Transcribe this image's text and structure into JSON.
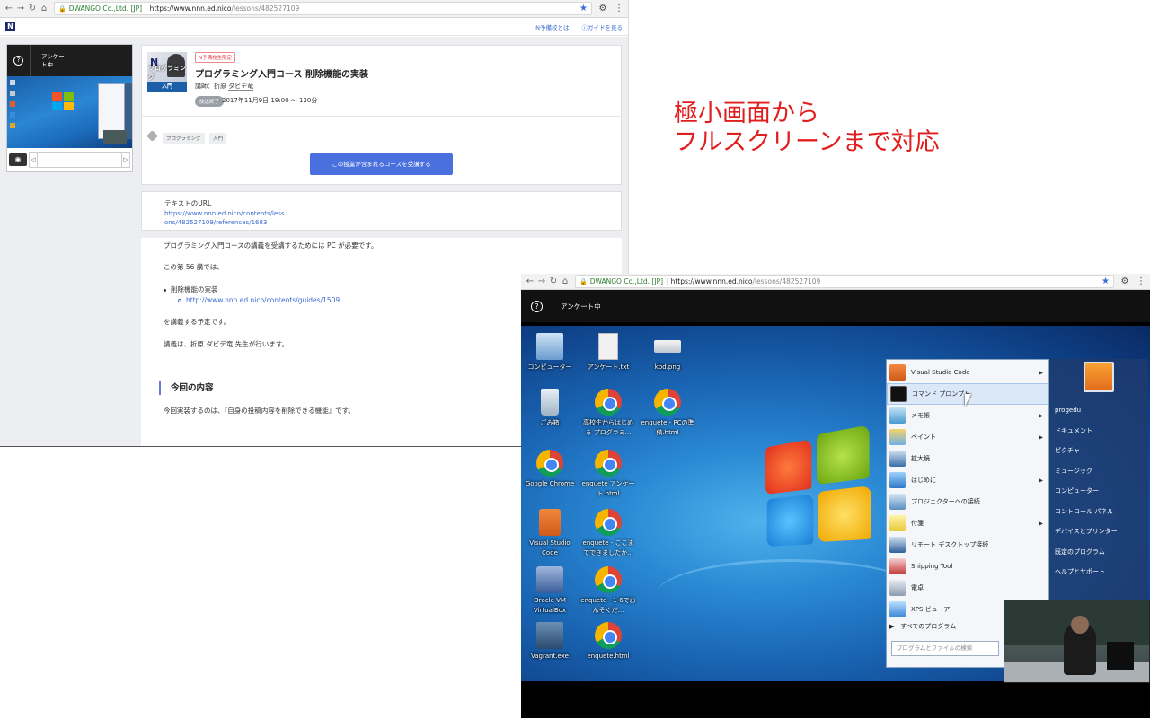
{
  "browser1": {
    "secure_label": "DWANGO Co.,Ltd. [JP]",
    "url_host": "https://www.nnn.ed.nico",
    "url_path": "/lessons/482527109",
    "header_links": [
      "N予備校とは",
      "ガイドを見る"
    ],
    "player": {
      "label": "アンケート中"
    },
    "lesson": {
      "badge": "N予備校生限定",
      "title": "プログラミング入門コース 削除機能の実装",
      "teacher_prefix": "講師：折原",
      "teacher_name": "ダビデ竜",
      "status": "放送終了",
      "datetime": "2017年11月9日 19:00 〜 120分",
      "thumb_logo": "N",
      "thumb_text": "プログラミング",
      "thumb_bar": "入門",
      "tags": [
        "プログラミング",
        "入門"
      ],
      "enroll_button": "この授業が含まれるコースを受講する"
    },
    "text_url": {
      "heading": "テキストのURL",
      "line1": "https://www.nnn.ed.nico/contents/less",
      "line2": "ons/482527109/references/1683"
    },
    "description": {
      "p1": "プログラミング入門コースの講義を受講するためには PC が必要です。",
      "p2": "この第 56 講では、",
      "bullet": "削除機能の実装",
      "bullet_link": "http://www.nnn.ed.nico/contents/guides/1509",
      "p3": "を講義する予定です。",
      "p4": "講義は、折原 ダビデ竜 先生が行います。",
      "section_title": "今回の内容",
      "p5": "今回実装するのは、『自身の投稿内容を削除できる機能』です。"
    }
  },
  "caption": {
    "line1": "極小画面から",
    "line2": "フルスクリーンまで対応"
  },
  "browser2": {
    "secure_label": "DWANGO Co.,Ltd. [JP]",
    "url_host": "https://www.nnn.ed.nico",
    "url_path": "/lessons/482527109",
    "label": "アンケート中",
    "desktop_icons": [
      {
        "label": "コンピューター"
      },
      {
        "label": "アンケート.txt"
      },
      {
        "label": "kbd.png"
      },
      {
        "label": "ごみ箱"
      },
      {
        "label": "高校生からはじめる プログラミ..."
      },
      {
        "label": "enquete - PCの準備.html"
      },
      {
        "label": "Google Chrome"
      },
      {
        "label": "enquete アンケート.html"
      },
      {
        "label": "Visual Studio Code"
      },
      {
        "label": "enquete - ここまでできましたか..."
      },
      {
        "label": "Oracle VM VirtualBox"
      },
      {
        "label": "enquete - 1-6でおんそくだ..."
      },
      {
        "label": "Vagrant.exe"
      },
      {
        "label": "enquete.html"
      }
    ],
    "start_menu": {
      "items": [
        "Visual Studio Code",
        "コマンド プロンプト",
        "メモ帳",
        "ペイント",
        "拡大鏡",
        "はじめに",
        "プロジェクターへの接続",
        "付箋",
        "リモート デスクトップ接続",
        "Snipping Tool",
        "電卓",
        "XPS ビューアー"
      ],
      "all_programs": "すべてのプログラム",
      "search_placeholder": "プログラムとファイルの検索",
      "right": [
        "progedu",
        "ドキュメント",
        "ピクチャ",
        "ミュージック",
        "コンピューター",
        "コントロール パネル",
        "デバイスとプリンター",
        "既定のプログラム",
        "ヘルプとサポート"
      ]
    }
  }
}
